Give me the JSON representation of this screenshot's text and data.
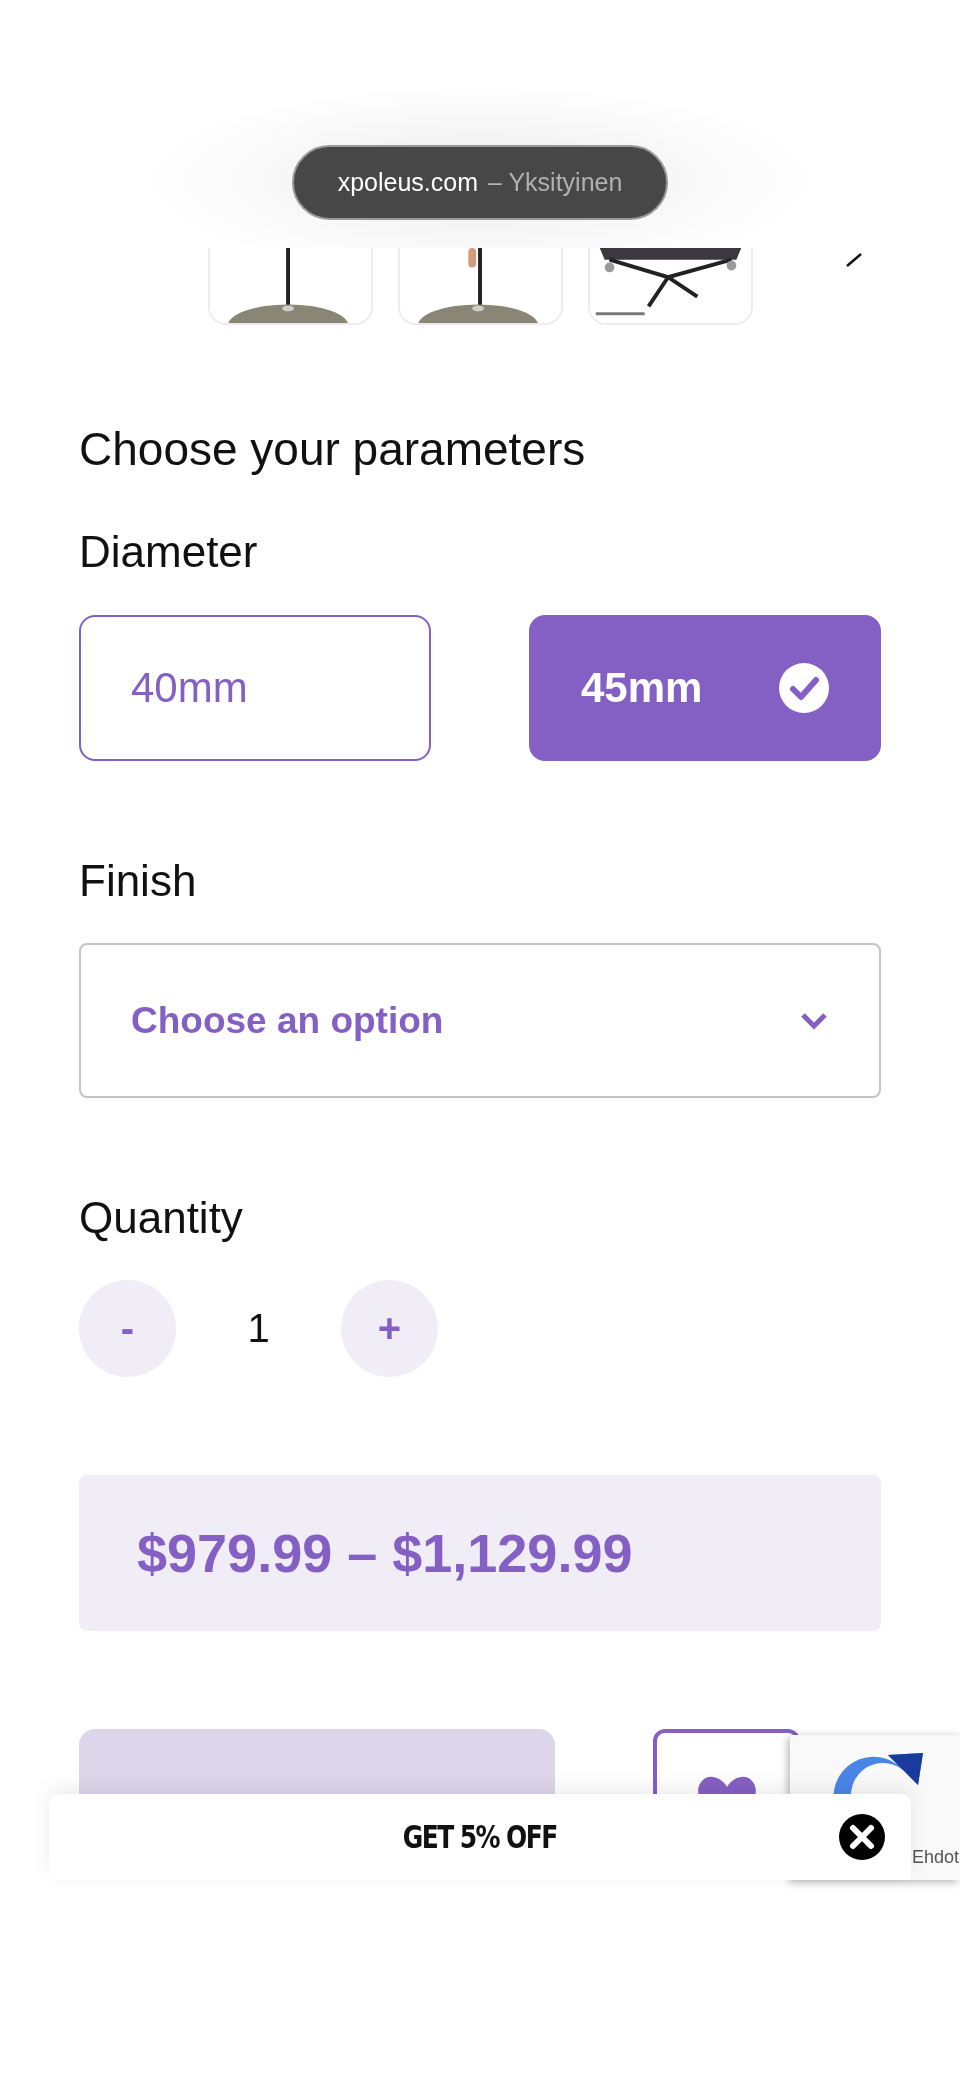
{
  "browser_bar": {
    "domain": "xpoleus.com",
    "mode": "– Yksityinen"
  },
  "parameters": {
    "title": "Choose your parameters"
  },
  "diameter": {
    "label": "Diameter",
    "options": [
      {
        "label": "40mm",
        "selected": false
      },
      {
        "label": "45mm",
        "selected": true
      }
    ]
  },
  "finish": {
    "label": "Finish",
    "placeholder": "Choose an option"
  },
  "quantity": {
    "label": "Quantity",
    "minus": "-",
    "value": "1",
    "plus": "+"
  },
  "price": "$979.99 – $1,129.99",
  "add_to_cart": {
    "disabled": true
  },
  "recaptcha": {
    "text": "Ehdot"
  },
  "popup": {
    "title": "GET 5% OFF"
  }
}
